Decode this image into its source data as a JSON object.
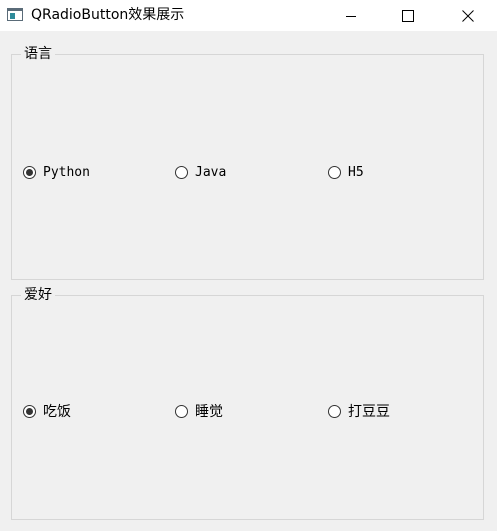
{
  "window": {
    "title": "QRadioButton效果展示",
    "icons": {
      "app": "app-window-icon",
      "minimize": "minimize-icon",
      "maximize": "maximize-icon",
      "close": "close-icon"
    }
  },
  "groups": [
    {
      "title": "语言",
      "options": [
        {
          "label": "Python",
          "checked": true
        },
        {
          "label": "Java",
          "checked": false
        },
        {
          "label": "H5",
          "checked": false
        }
      ]
    },
    {
      "title": "爱好",
      "options": [
        {
          "label": "吃饭",
          "checked": true
        },
        {
          "label": "睡觉",
          "checked": false
        },
        {
          "label": "打豆豆",
          "checked": false
        }
      ]
    }
  ]
}
